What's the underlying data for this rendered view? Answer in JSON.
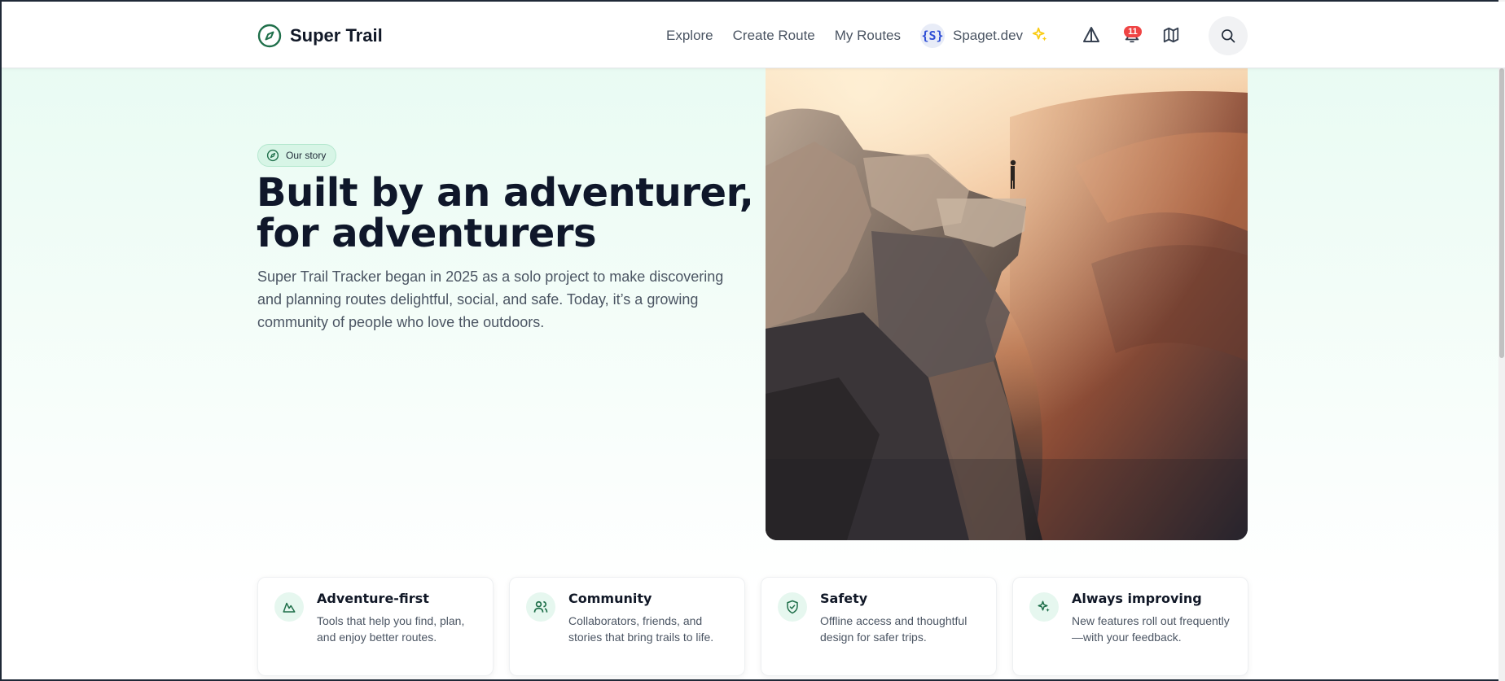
{
  "header": {
    "brand": "Super Trail",
    "nav": {
      "explore": "Explore",
      "create_route": "Create Route",
      "my_routes": "My Routes"
    },
    "org": {
      "badge": "{S}",
      "name": "Spaget.dev"
    },
    "notification_count": "11"
  },
  "hero": {
    "pill": "Our story",
    "title_line1": "Built by an adventurer,",
    "title_line2": "for adventurers",
    "description": "Super Trail Tracker began in 2025 as a solo project to make discovering and planning routes delightful, social, and safe. Today, it’s a growing community of people who love the outdoors."
  },
  "features": [
    {
      "icon": "mountain-icon",
      "title": "Adventure-first",
      "description": "Tools that help you find, plan, and enjoy better routes."
    },
    {
      "icon": "users-icon",
      "title": "Community",
      "description": "Collaborators, friends, and stories that bring trails to life."
    },
    {
      "icon": "shield-check-icon",
      "title": "Safety",
      "description": "Offline access and thoughtful design for safer trips."
    },
    {
      "icon": "sparkles-icon",
      "title": "Always improving",
      "description": "New features roll out frequently—with your feedback."
    }
  ],
  "colors": {
    "brand_green": "#1f6f4a",
    "accent_yellow": "#facc15",
    "badge_red": "#ef4444",
    "hero_bg": "#e9fbf3"
  }
}
